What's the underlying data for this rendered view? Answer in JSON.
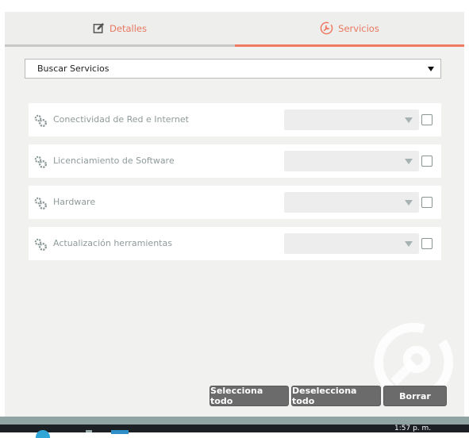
{
  "tabs": [
    {
      "label": "Detalles",
      "icon": "edit-icon",
      "active": false
    },
    {
      "label": "Servicios",
      "icon": "wrench-icon",
      "active": true
    }
  ],
  "search_select": {
    "value": "Buscar Servicios"
  },
  "services": [
    {
      "label": "Conectividad de Red e Internet",
      "selected_value": "",
      "checked": false
    },
    {
      "label": "Licenciamiento de Software",
      "selected_value": "",
      "checked": false
    },
    {
      "label": "Hardware",
      "selected_value": "",
      "checked": false
    },
    {
      "label": "Actualización herramientas",
      "selected_value": "",
      "checked": false
    }
  ],
  "buttons": {
    "select_all": "Selecciona todo",
    "deselect_all": "Deselecciona todo",
    "clear": "Borrar"
  },
  "taskbar": {
    "clock": "1:57 p. m."
  },
  "colors": {
    "accent": "#e8775f",
    "panel_bg": "#f1f1f0",
    "button_bg": "#6b6b6b",
    "taskbar_bg": "#1c1f23"
  }
}
